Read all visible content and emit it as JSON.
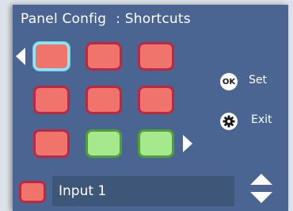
{
  "header": {
    "title": "Panel Config",
    "section": ": Shortcuts"
  },
  "grid": [
    {
      "row": 1,
      "col": 1,
      "color": "red",
      "selected": true
    },
    {
      "row": 1,
      "col": 2,
      "color": "red",
      "selected": false
    },
    {
      "row": 1,
      "col": 3,
      "color": "red",
      "selected": false
    },
    {
      "row": 2,
      "col": 1,
      "color": "red",
      "selected": false
    },
    {
      "row": 2,
      "col": 2,
      "color": "red",
      "selected": false
    },
    {
      "row": 2,
      "col": 3,
      "color": "red",
      "selected": false
    },
    {
      "row": 3,
      "col": 1,
      "color": "red",
      "selected": false
    },
    {
      "row": 3,
      "col": 2,
      "color": "green",
      "selected": false
    },
    {
      "row": 3,
      "col": 3,
      "color": "green",
      "selected": false
    }
  ],
  "actions": {
    "ok_icon_text": "OK",
    "set_label": "Set",
    "exit_label": "Exit"
  },
  "footer": {
    "input_value": "Input 1"
  },
  "colors": {
    "panel_bg": "#4a6591",
    "red_fill": "#f0736c",
    "red_border": "#b82a43",
    "green_fill": "#a6e98c",
    "green_border": "#4f9e3e",
    "selection": "#8fe6f2"
  },
  "icons": [
    "arrow-left-icon",
    "arrow-right-icon",
    "ok-icon",
    "gear-icon",
    "scroll-up-icon",
    "scroll-down-icon"
  ]
}
